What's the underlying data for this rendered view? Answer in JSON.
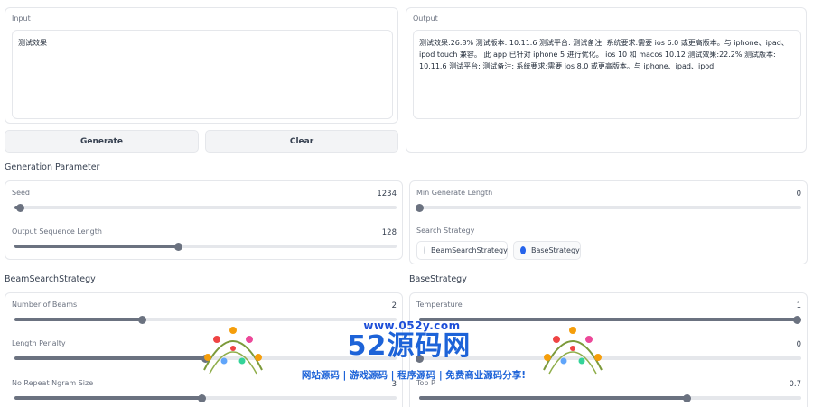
{
  "input": {
    "label": "Input",
    "value": "测试效果"
  },
  "output": {
    "label": "Output",
    "value": "测试效果:26.8% 测试版本: 10.11.6 测试平台: 测试备注: 系统要求:需要 ios 6.0 或更高版本。与 iphone、ipad、ipod touch 兼容。 此 app 已针对 iphone 5 进行优化。 ios 10 和 macos 10.12 测试效果:22.2% 测试版本: 10.11.6 测试平台: 测试备注: 系统要求:需要 ios 8.0 或更高版本。与 iphone、ipad、ipod"
  },
  "buttons": {
    "generate": "Generate",
    "clear": "Clear"
  },
  "generation": {
    "title": "Generation Parameter",
    "seed": {
      "label": "Seed",
      "value": "1234",
      "fraction": 0.015
    },
    "output_len": {
      "label": "Output Sequence Length",
      "value": "128",
      "fraction": 0.43
    },
    "min_len": {
      "label": "Min Generate Length",
      "value": "0",
      "fraction": 0.0
    },
    "strategy": {
      "label": "Search Strategy",
      "options": [
        "BeamSearchStrategy",
        "BaseStrategy"
      ],
      "selected": "BaseStrategy"
    }
  },
  "beam": {
    "title": "BeamSearchStrategy",
    "num_beams": {
      "label": "Number of Beams",
      "value": "2",
      "fraction": 0.335
    },
    "length_penalty": {
      "label": "Length Penalty",
      "value": "",
      "fraction": 0.5
    },
    "no_repeat": {
      "label": "No Repeat Ngram Size",
      "value": "3",
      "fraction": 0.49
    }
  },
  "base": {
    "title": "BaseStrategy",
    "temperature": {
      "label": "Temperature",
      "value": "1",
      "fraction": 1.0
    },
    "top_k": {
      "label": "",
      "value": "0",
      "fraction": 0.0
    },
    "top_p": {
      "label": "Top P",
      "value": "0.7",
      "fraction": 0.7
    }
  },
  "watermark": {
    "url": "www.052y.com",
    "logo": "52源码网",
    "slogan": "网站源码 | 游戏源码 | 程序源码 | 免费商业源码分享!"
  },
  "colors": {
    "accent": "#2563eb",
    "slider": "#6b7280",
    "watermark": "#1d63d8"
  }
}
